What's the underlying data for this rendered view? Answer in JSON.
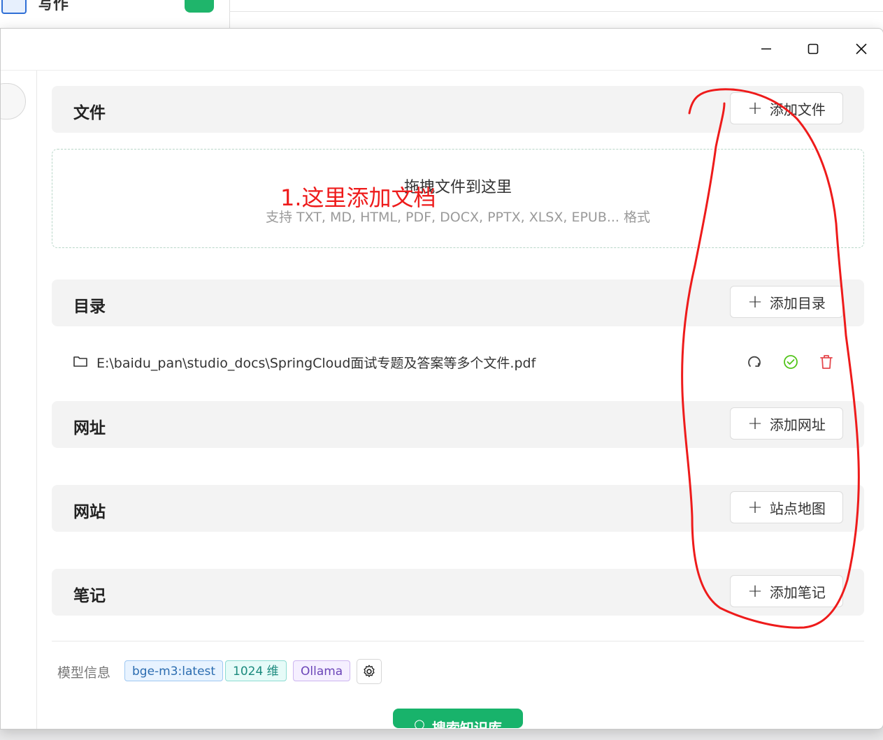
{
  "background_app": {
    "title": "写作"
  },
  "window_controls": {
    "minimize_icon": "minimize-icon",
    "maximize_icon": "maximize-icon",
    "close_icon": "close-icon"
  },
  "sections": {
    "files": {
      "title": "文件",
      "button_label": "添加文件"
    },
    "directory": {
      "title": "目录",
      "button_label": "添加目录"
    },
    "url": {
      "title": "网址",
      "button_label": "添加网址"
    },
    "website": {
      "title": "网站",
      "button_label": "站点地图"
    },
    "notes": {
      "title": "笔记",
      "button_label": "添加笔记"
    }
  },
  "dropzone": {
    "main_text": "拖拽文件到这里",
    "sub_text": "支持 TXT, MD, HTML, PDF, DOCX, PPTX, XLSX, EPUB... 格式"
  },
  "directory_items": [
    {
      "path": "E:\\baidu_pan\\studio_docs\\SpringCloud面试专题及答案等多个文件.pdf"
    }
  ],
  "model_info": {
    "label": "模型信息",
    "tags": [
      "bge-m3:latest",
      "1024 维",
      "Ollama"
    ]
  },
  "search_button": {
    "label": "搜索知识库"
  },
  "annotation": {
    "text": "1.这里添加文档",
    "color": "#ee1b1b"
  },
  "colors": {
    "accent_green": "#18b36b",
    "annotation_red": "#ee1b1b",
    "delete_red": "#e5484d",
    "check_green": "#52c41a"
  }
}
